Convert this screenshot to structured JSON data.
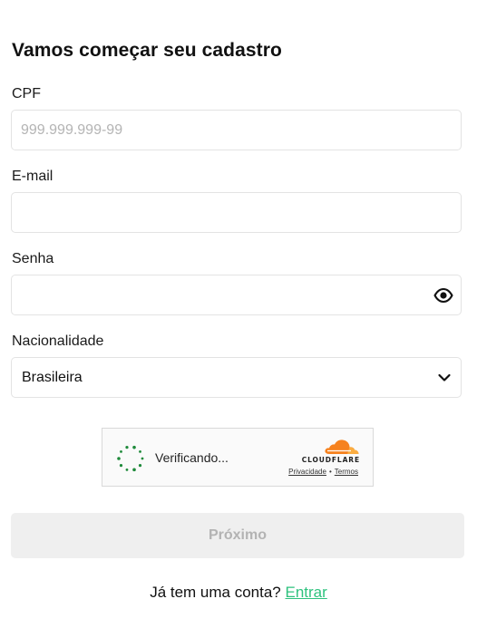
{
  "form": {
    "title": "Vamos começar seu cadastro",
    "cpf": {
      "label": "CPF",
      "placeholder": "999.999.999-99",
      "value": ""
    },
    "email": {
      "label": "E-mail",
      "placeholder": "",
      "value": ""
    },
    "password": {
      "label": "Senha",
      "placeholder": "",
      "value": "",
      "toggle_icon": "eye-icon"
    },
    "nationality": {
      "label": "Nacionalidade",
      "selected": "Brasileira",
      "dropdown_icon": "chevron-down-icon"
    },
    "submit_label": "Próximo",
    "submit_disabled": true
  },
  "captcha": {
    "status": "Verificando...",
    "brand": "CLOUDFLARE",
    "privacy_label": "Privacidade",
    "separator": "•",
    "terms_label": "Termos",
    "spinner_icon": "loading-spinner-icon",
    "logo_icon": "cloudflare-cloud-icon",
    "spinner_color": "#1e8a3a"
  },
  "footer": {
    "prompt": "Já tem uma conta?",
    "login_label": "Entrar",
    "link_color": "#2ec27e"
  }
}
